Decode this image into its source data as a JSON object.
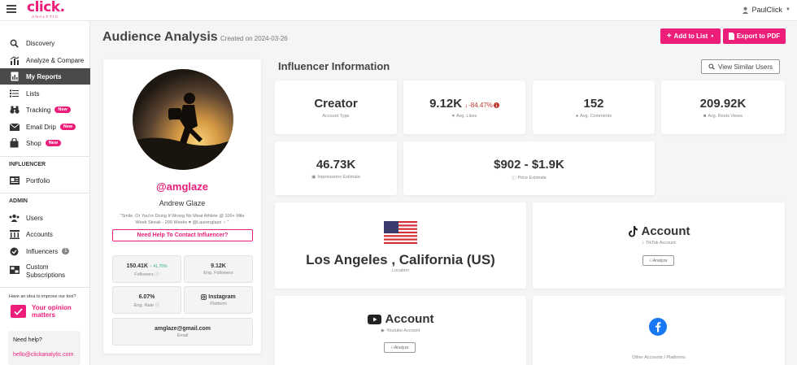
{
  "app": {
    "logo": "click.",
    "logo_sub": "ANALYTIC",
    "user_name": "PaulClick"
  },
  "sidebar": {
    "items": [
      {
        "label": "Discovery",
        "icon": "search-icon"
      },
      {
        "label": "Analyze & Compare",
        "icon": "chart-icon"
      },
      {
        "label": "My Reports",
        "icon": "report-icon",
        "active": true
      },
      {
        "label": "Lists",
        "icon": "list-icon"
      },
      {
        "label": "Tracking",
        "icon": "binoculars-icon",
        "badge": "New"
      },
      {
        "label": "Email Drip",
        "icon": "mail-icon",
        "badge": "New"
      },
      {
        "label": "Shop",
        "icon": "bag-icon",
        "badge": "New"
      }
    ],
    "influencer_section": "INFLUENCER",
    "influencer_items": [
      {
        "label": "Portfolio",
        "icon": "portfolio-icon"
      }
    ],
    "admin_section": "ADMIN",
    "admin_items": [
      {
        "label": "Users",
        "icon": "users-icon"
      },
      {
        "label": "Accounts",
        "icon": "accounts-icon"
      },
      {
        "label": "Influencers",
        "icon": "verified-icon",
        "count": "1"
      },
      {
        "label": "Custom Subscriptions",
        "icon": "subscriptions-icon"
      }
    ],
    "idea_text": "Have an idea to improve our tool?",
    "opinion_text": "Your opinion matters",
    "help_title": "Need help?",
    "help_email": "hello@clickanalytic.com"
  },
  "header": {
    "title": "Audience Analysis",
    "created": "Created on 2024-03-26",
    "add_to_list": "Add to List",
    "export_pdf": "Export to PDF"
  },
  "profile": {
    "handle": "@amglaze",
    "name": "Andrew Glaze",
    "bio": "\"Smile, Or You're Doing It Wrong No Meat Athlete @ 100+ Mile Week Streak - 209 Weeks ♥ @Laurenglaze ♁ \"",
    "contact_label": "Need Help To Contact Influencer?",
    "followers": "150.41K",
    "followers_change": "41.76%",
    "followers_label": "Followers",
    "eng_followers": "9.12K",
    "eng_followers_label": "Eng. Followers",
    "eng_rate": "6.07%",
    "eng_rate_label": "Eng. Rate",
    "platform": "Instagram",
    "platform_label": "Platform",
    "email": "amglaze@gmail.com",
    "email_label": "Email"
  },
  "info": {
    "title": "Influencer Information",
    "similar_label": "View Similar Users",
    "account_type": "Creator",
    "account_type_label": "Account Type",
    "avg_likes": "9.12K",
    "avg_likes_change": "-84.47%",
    "avg_likes_label": "Avg. Likes",
    "avg_comments": "152",
    "avg_comments_label": "Avg. Comments",
    "avg_reels": "209.92K",
    "avg_reels_label": "Avg. Reels Views",
    "impressions": "46.73K",
    "impressions_label": "Impressions Estimate",
    "price": "$902 - $1.9K",
    "price_label": "Price Estimate",
    "location": "Los Angeles , California (US)",
    "location_label": "Location",
    "tiktok_title": "Account",
    "tiktok_label": "TikTok Account",
    "youtube_title": "Account",
    "youtube_label": "Youtube Account",
    "analyze_label": "Analyze",
    "other_label": "Other Accounts / Platforms"
  },
  "colors": {
    "brand": "#ec1e79",
    "dark_nav": "#4a4a4a",
    "down": "#c0392b",
    "up": "#2bb673"
  }
}
